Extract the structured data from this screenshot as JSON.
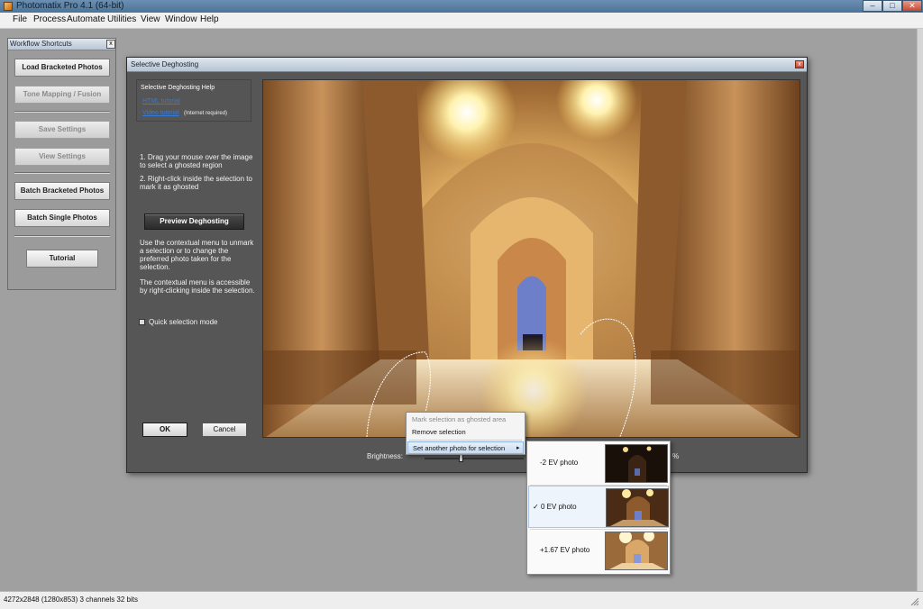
{
  "window": {
    "title": "Photomatix Pro 4.1 (64-bit)",
    "controls": {
      "minimize": "–",
      "maximize": "□",
      "close": "✕"
    }
  },
  "menubar": [
    "File",
    "Process",
    "Automate",
    "Utilities",
    "View",
    "Window",
    "Help"
  ],
  "workflow_panel": {
    "title": "Workflow Shortcuts",
    "close": "x",
    "buttons": {
      "load_bracketed": "Load Bracketed Photos",
      "tone_mapping": "Tone Mapping / Fusion",
      "save_settings": "Save Settings",
      "view_settings": "View Settings",
      "batch_bracketed": "Batch Bracketed Photos",
      "batch_single": "Batch Single Photos",
      "tutorial": "Tutorial"
    }
  },
  "dialog": {
    "title": "Selective Deghosting",
    "close": "x",
    "help": {
      "title": "Selective Deghosting Help",
      "html_link": "HTML tutorial",
      "video_link": "Video tutorial",
      "video_note": "(Internet required)"
    },
    "instructions": {
      "step1": "1. Drag your  mouse over the image to select a ghosted region",
      "step2": "2. Right-click inside the selection to mark it as ghosted",
      "contextual1": "Use the contextual menu to unmark a selection or to change the preferred photo taken for the selection.",
      "contextual2": "The contextual menu is accessible by right-clicking inside the selection."
    },
    "preview_button": "Preview Deghosting",
    "quick_selection_label": "Quick selection mode",
    "quick_selection_checked": false,
    "ok_button": "OK",
    "cancel_button": "Cancel",
    "brightness_label": "Brightness:",
    "brightness_suffix": "%"
  },
  "context_menu": {
    "mark": "Mark selection as ghosted area",
    "remove": "Remove selection",
    "set_another": "Set another photo for selection",
    "arrow": "▸"
  },
  "photo_submenu": [
    {
      "label": "-2 EV photo",
      "checked": false
    },
    {
      "label": "0 EV photo",
      "checked": true
    },
    {
      "label": "+1.67 EV photo",
      "checked": false
    }
  ],
  "check_mark": "✓",
  "statusbar": {
    "text": "4272x2848 (1280x853) 3 channels 32 bits"
  },
  "colors": {
    "workspace": "#a0a0a0",
    "dialog_bg": "#565656",
    "link": "#3a7ad4",
    "highlight": "#c7dbf2"
  }
}
